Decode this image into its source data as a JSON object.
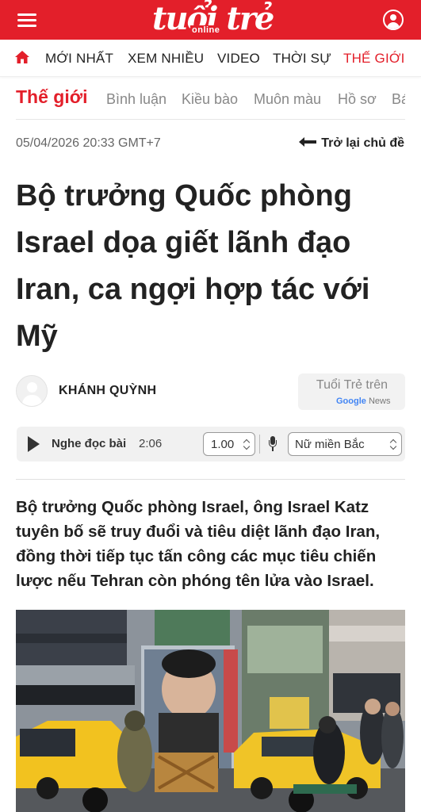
{
  "header": {
    "logo_main": "tuổi trẻ",
    "logo_sub": "online"
  },
  "nav": {
    "items": [
      "MỚI NHẤT",
      "XEM NHIỀU",
      "VIDEO",
      "THỜI SỰ",
      "THẾ GIỚI"
    ]
  },
  "section": {
    "title": "Thế giới",
    "items": [
      "Bình luận",
      "Kiều bào",
      "Muôn màu",
      "Hồ sơ",
      "Bá"
    ]
  },
  "article": {
    "date": "05/04/2026 20:33 GMT+7",
    "back_label": "Trở lại chủ đề",
    "headline": "Bộ trưởng Quốc phòng Israel dọa giết lãnh đạo Iran, ca ngợi hợp tác với Mỹ",
    "author": "KHÁNH QUỲNH",
    "lede": "Bộ trưởng Quốc phòng Israel, ông Israel Katz tuyên bố sẽ truy đuổi và tiêu diệt lãnh đạo Iran, đồng thời tiếp tục tấn công các mục tiêu chiến lược nếu Tehran còn phóng tên lửa vào Israel."
  },
  "gnews": {
    "label": "Tuổi Trẻ trên",
    "brand": "Google",
    "brand_suffix": "News"
  },
  "audio": {
    "label": "Nghe đọc bài",
    "duration": "2:06",
    "speed": "1.00",
    "voice": "Nữ miền Bắc"
  },
  "colors": {
    "brand_red": "#e31f2a",
    "muted_text": "#888888"
  },
  "icons": [
    "menu-icon",
    "user-icon",
    "home-icon",
    "arrow-left-icon",
    "play-icon",
    "microphone-icon",
    "chevron-updown-icon"
  ]
}
